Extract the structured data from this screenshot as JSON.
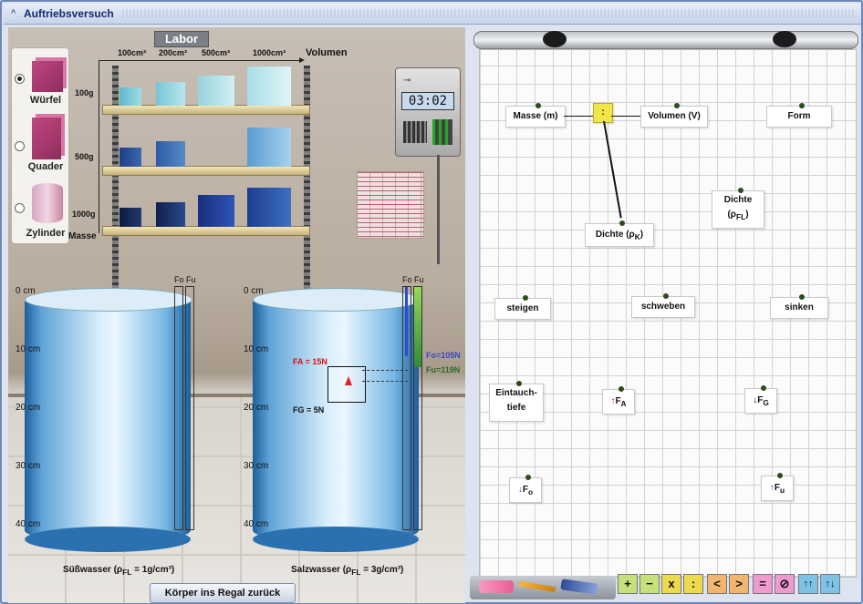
{
  "window": {
    "title": "Auftriebsversuch"
  },
  "lab": {
    "sign": "Labor",
    "shapes": [
      {
        "label": "Würfel",
        "selected": true
      },
      {
        "label": "Quader",
        "selected": false
      },
      {
        "label": "Zylinder",
        "selected": false
      }
    ],
    "volume_axis_title": "Volumen",
    "volume_labels": [
      "100cm³",
      "200cm³",
      "500cm³",
      "1000cm³"
    ],
    "mass_axis_title": "Masse",
    "mass_labels": [
      "100g",
      "500g",
      "1000g"
    ],
    "timer": "03:02",
    "tank_left": {
      "scale": [
        "0 cm",
        "10 cm",
        "20 cm",
        "30 cm",
        "40 cm"
      ],
      "fo": "Fo",
      "fu": "Fu",
      "label": "Süßwasser (ρ",
      "label_sub": "FL",
      "label_tail": " = 1g/cm³)"
    },
    "tank_right": {
      "scale": [
        "0 cm",
        "10 cm",
        "20 cm",
        "30 cm",
        "40 cm"
      ],
      "fo": "Fo",
      "fu": "Fu",
      "label": "Salzwasser (ρ",
      "label_sub": "FL",
      "label_tail": " = 3g/cm³)",
      "fa": "FA = 15N",
      "fg": "FG = 5N",
      "fo_value": "Fo=105N",
      "fu_value": "Fu=119N"
    },
    "return_button": "Körper ins Regal zurück"
  },
  "board": {
    "cards": {
      "masse": "Masse (m)",
      "colon": ":",
      "volumen": "Volumen (V)",
      "form": "Form",
      "dichte_k": "Dichte (ρ",
      "dichte_k_sub": "K",
      "dichte_k_tail": ")",
      "dichte_fl_line1": "Dichte",
      "dichte_fl_line2": "(ρ",
      "dichte_fl_sub": "FL",
      "dichte_fl_tail": ")",
      "steigen": "steigen",
      "schweben": "schweben",
      "sinken": "sinken",
      "eintauch_line1": "Eintauch-",
      "eintauch_line2": "tiefe",
      "fa_main": "F",
      "fa_sub": "A",
      "fg_main": "F",
      "fg_sub": "G",
      "fo_main": "F",
      "fo_sub": "o",
      "fu_main": "F",
      "fu_sub": "u"
    },
    "toolbar": {
      "plus": "+",
      "minus": "−",
      "times": "x",
      "divide": ":",
      "less": "<",
      "greater": ">",
      "equals": "=",
      "clear": "⊘",
      "up_up": "↑↑",
      "up_down": "↑↓"
    }
  }
}
